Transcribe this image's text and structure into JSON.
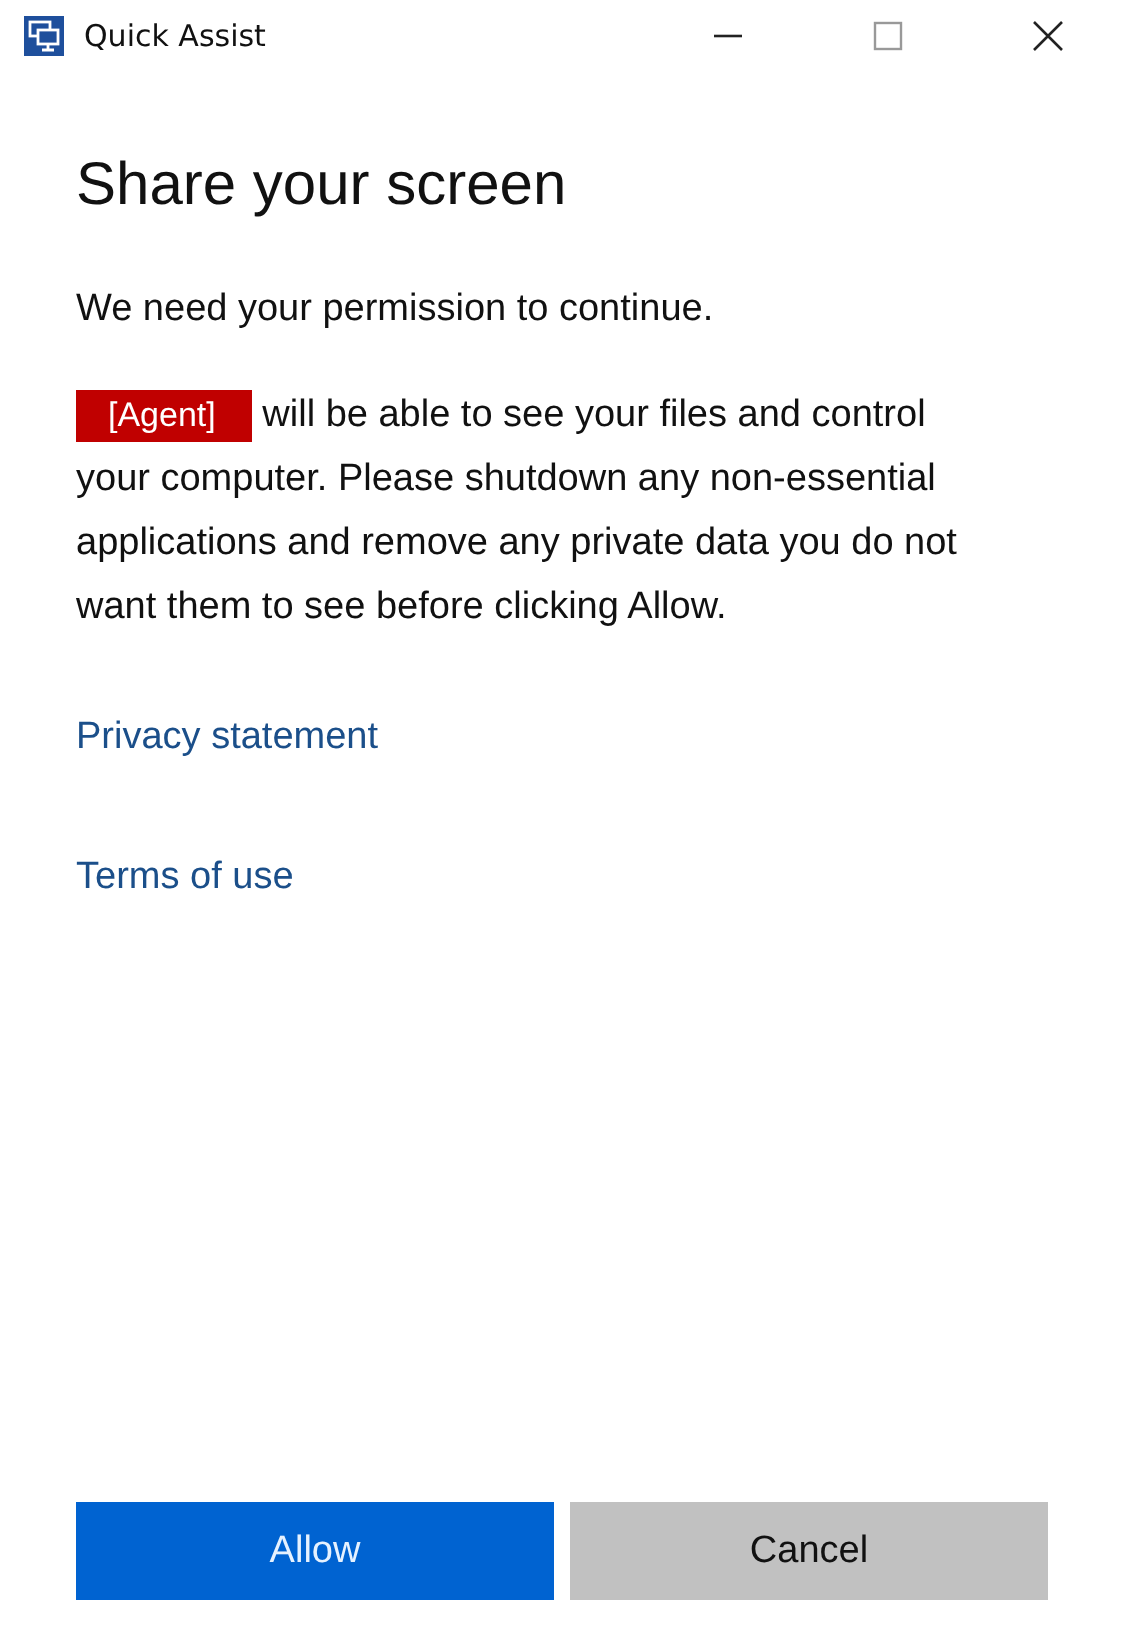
{
  "window": {
    "title": "Quick Assist"
  },
  "heading": "Share your screen",
  "intro": "We need your permission to continue.",
  "notice": {
    "tag": "[Agent]",
    "text": "will be able to see your files and control your computer. Please shutdown any non-essential applications and remove any private data you do not want them to see before clicking Allow."
  },
  "links": [
    "Privacy statement",
    "Terms of use"
  ],
  "buttons": [
    {
      "label": "Allow",
      "kind": "primary"
    },
    {
      "label": "Cancel",
      "kind": "secondary"
    }
  ]
}
